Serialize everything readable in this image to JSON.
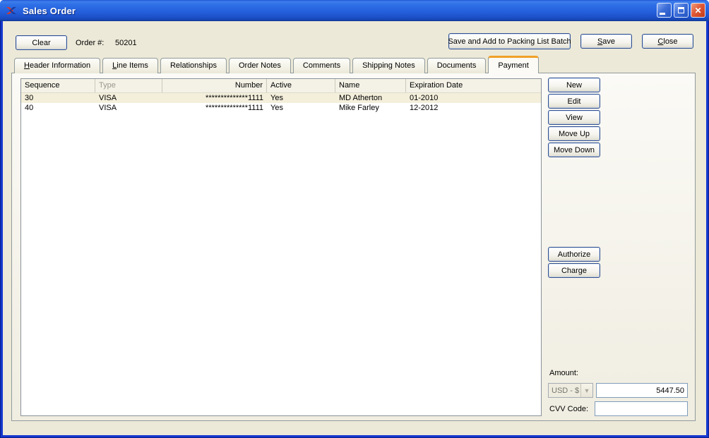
{
  "window": {
    "title": "Sales Order"
  },
  "icons": {
    "close": "✕",
    "dropdown_chevron": "▼"
  },
  "toolbar": {
    "clear_label": "Clear",
    "order_label": "Order #:",
    "order_number": "50201",
    "save_batch_label": "Save and Add to Packing List Batch",
    "save_label": "Save",
    "close_label": "Close"
  },
  "tabs": [
    {
      "label": "Header Information",
      "active": false
    },
    {
      "label": "Line Items",
      "active": false
    },
    {
      "label": "Relationships",
      "active": false
    },
    {
      "label": "Order Notes",
      "active": false
    },
    {
      "label": "Comments",
      "active": false
    },
    {
      "label": "Shipping Notes",
      "active": false
    },
    {
      "label": "Documents",
      "active": false
    },
    {
      "label": "Payment",
      "active": true
    }
  ],
  "table": {
    "columns": [
      "Sequence",
      "Type",
      "Number",
      "Active",
      "Name",
      "Expiration Date"
    ],
    "rows": [
      {
        "sequence": "30",
        "type": "VISA",
        "number": "**************1111",
        "active": "Yes",
        "name": "MD Atherton",
        "expiration": "01-2010",
        "selected": true
      },
      {
        "sequence": "40",
        "type": "VISA",
        "number": "**************1111",
        "active": "Yes",
        "name": "Mike Farley",
        "expiration": "12-2012",
        "selected": false
      }
    ]
  },
  "actions": {
    "new": "New",
    "edit": "Edit",
    "view": "View",
    "move_up": "Move Up",
    "move_down": "Move Down",
    "authorize": "Authorize",
    "charge": "Charge"
  },
  "payment": {
    "amount_label": "Amount:",
    "currency": "USD - $",
    "amount_value": "5447.50",
    "cvv_label": "CVV Code:",
    "cvv_value": ""
  },
  "colors": {
    "titlebar_blue": "#2560DC",
    "frame_blue": "#1537CE",
    "window_background": "#ECE9D8",
    "panel_border": "#919B9C",
    "active_tab_accent_orange": "#F0A028",
    "field_border": "#7F9DB9",
    "button_border": "#2F4F8F",
    "selected_row_background": "#F4EFDB",
    "close_button_red": "#E05A38"
  }
}
